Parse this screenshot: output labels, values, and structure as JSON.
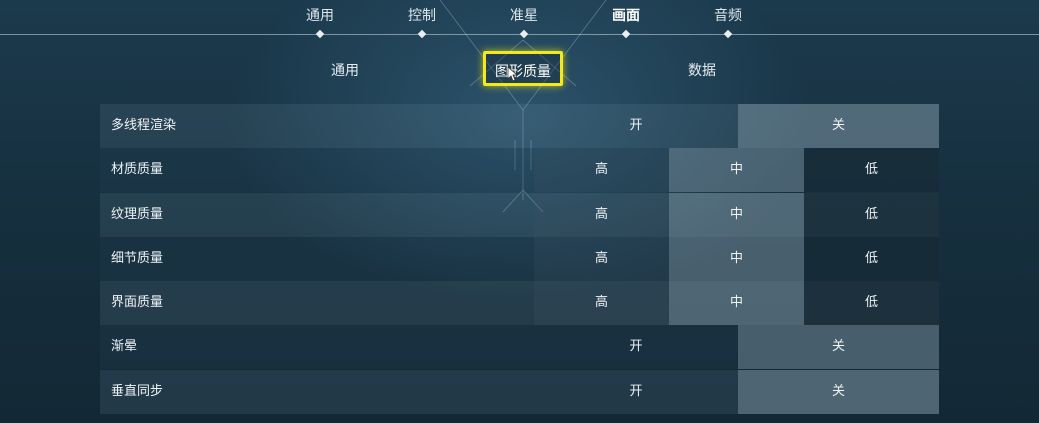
{
  "top_tabs": [
    {
      "label": "通用",
      "active": false
    },
    {
      "label": "控制",
      "active": false
    },
    {
      "label": "准星",
      "active": false
    },
    {
      "label": "画面",
      "active": true
    },
    {
      "label": "音频",
      "active": false
    }
  ],
  "sub_tabs": [
    {
      "label": "通用",
      "selected": false
    },
    {
      "label": "图形质量",
      "selected": true
    },
    {
      "label": "数据",
      "selected": false
    }
  ],
  "settings": [
    {
      "label": "多线程渲染",
      "options": [
        "开",
        "关"
      ],
      "selected": 1
    },
    {
      "label": "材质质量",
      "options": [
        "高",
        "中",
        "低"
      ],
      "selected": 1
    },
    {
      "label": "纹理质量",
      "options": [
        "高",
        "中",
        "低"
      ],
      "selected": 1
    },
    {
      "label": "细节质量",
      "options": [
        "高",
        "中",
        "低"
      ],
      "selected": 1
    },
    {
      "label": "界面质量",
      "options": [
        "高",
        "中",
        "低"
      ],
      "selected": 1
    },
    {
      "label": "渐晕",
      "options": [
        "开",
        "关"
      ],
      "selected": 1
    },
    {
      "label": "垂直同步",
      "options": [
        "开",
        "关"
      ],
      "selected": 1
    }
  ],
  "colors": {
    "highlight": "#f3ea1b",
    "selected_option": "#8aa2b3"
  }
}
